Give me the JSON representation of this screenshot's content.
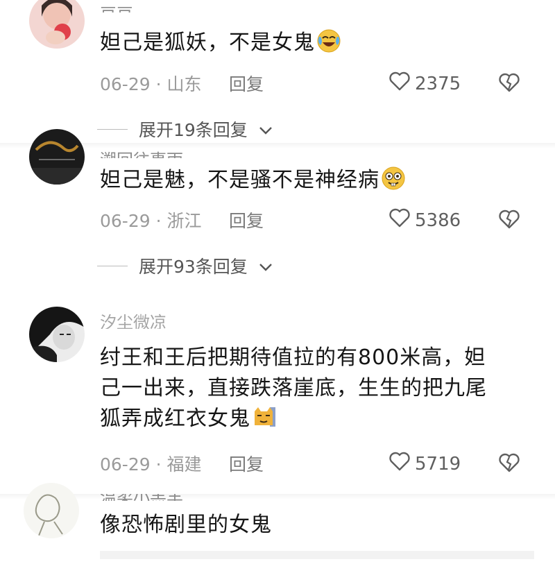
{
  "comments": [
    {
      "username": "豆豆",
      "text": "妲己是狐妖，不是女鬼",
      "emoji": "laughing-crying-emoji",
      "date": "06-29",
      "location": "山东",
      "reply_label": "回复",
      "likes": "2375",
      "expand_label": "展开19条回复"
    },
    {
      "username": "溯回往事雨",
      "text": "妲己是魅，不是骚不是神经病",
      "emoji": "silly-face-emoji",
      "date": "06-29",
      "location": "浙江",
      "reply_label": "回复",
      "likes": "5386",
      "expand_label": "展开93条回复"
    },
    {
      "username": "汐尘微凉",
      "text_line1": "纣王和王后把期待值拉的有800米高，妲",
      "text_line2": "己一出来，直接跌落崖底，生生的把九尾",
      "text_line3": "狐弄成红衣女鬼",
      "emoji": "cat-emoji",
      "date": "06-29",
      "location": "福建",
      "reply_label": "回复",
      "likes": "5719"
    },
    {
      "username": "温柔小羔羊",
      "text": "像恐怖剧里的女鬼"
    }
  ],
  "colors": {
    "text": "#161616",
    "meta": "#9a9a9a",
    "accent_emoji": "#f4c542"
  }
}
